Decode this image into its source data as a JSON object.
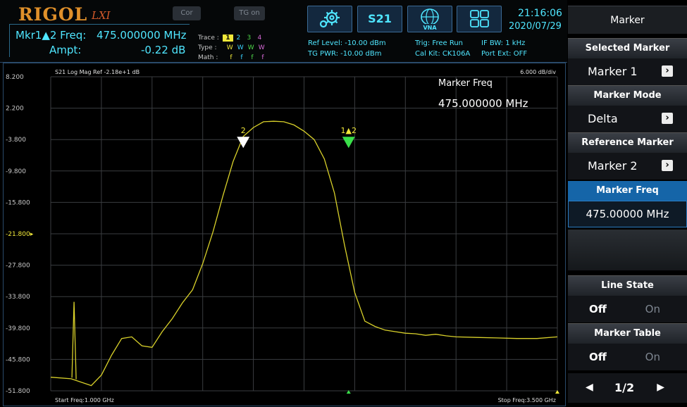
{
  "brand": {
    "logo": "RIGOL",
    "lxi": "LXI"
  },
  "top_buttons": {
    "cor": "Cor",
    "tg_on": "TG on",
    "s21": "S21",
    "vna": "VNA"
  },
  "marker_readout": {
    "freq_label": "Mkr1▲2 Freq:",
    "freq_value": "475.000000 MHz",
    "ampt_label": "Ampt:",
    "ampt_value": "-0.22 dB"
  },
  "trace_panel": {
    "trace_label": "Trace :",
    "trace_values": [
      "1",
      "2",
      "3",
      "4"
    ],
    "type_label": "Type :",
    "type_values": [
      "W",
      "W",
      "W",
      "W"
    ],
    "math_label": "Math :",
    "math_values": [
      "f",
      "f",
      "f",
      "f"
    ],
    "trace_colors": [
      "#f1e83a",
      "#3ad1ff",
      "#4fd94a",
      "#d96ad9"
    ]
  },
  "status": {
    "ref_level": "Ref Level: -10.00 dBm",
    "tg_pwr": "TG PWR: -10.00 dBm",
    "trig": "Trig: Free Run",
    "cal_kit": "Cal Kit: CK106A",
    "if_bw": "IF BW: 1 kHz",
    "port_ext": "Port Ext: OFF"
  },
  "clock": {
    "time": "21:16:06",
    "date": "2020/07/29"
  },
  "plot": {
    "header_left": "S21  Log Mag    Ref -2.18e+1 dB",
    "header_right": "6.000  dB/div",
    "y_ticks": [
      "8.200",
      "2.200",
      "-3.800",
      "-9.800",
      "-15.800",
      "-21.800",
      "-27.800",
      "-33.800",
      "-39.800",
      "-45.800",
      "-51.800"
    ],
    "start_freq": "Start Freq:1.000 GHz",
    "stop_freq": "Stop Freq:3.500 GHz",
    "marker_freq_title": "Marker Freq",
    "marker_freq_value": "475.000000 MHz",
    "marker_2_label": "2",
    "marker_1_label": "1▲2",
    "trace_color": "#d9d12a"
  },
  "chart_data": {
    "type": "line",
    "x_unit": "GHz",
    "xlim": [
      1.0,
      3.5
    ],
    "ylim": [
      -51.8,
      8.2
    ],
    "y_unit": "dB",
    "x": [
      1.0,
      1.1,
      1.2,
      1.25,
      1.3,
      1.35,
      1.4,
      1.45,
      1.5,
      1.55,
      1.6,
      1.65,
      1.7,
      1.75,
      1.8,
      1.85,
      1.9,
      1.95,
      2.0,
      2.05,
      2.1,
      2.15,
      2.2,
      2.25,
      2.3,
      2.35,
      2.4,
      2.45,
      2.5,
      2.55,
      2.6,
      2.65,
      2.7,
      2.75,
      2.8,
      2.85,
      2.9,
      2.95,
      3.0,
      3.1,
      3.2,
      3.3,
      3.4,
      3.5
    ],
    "y": [
      -49.2,
      -49.5,
      -50.8,
      -48.8,
      -45.0,
      -41.8,
      -41.5,
      -43.2,
      -43.5,
      -40.5,
      -38.0,
      -35.0,
      -32.5,
      -27.5,
      -21.5,
      -14.5,
      -8.0,
      -3.2,
      -1.5,
      -0.4,
      -0.3,
      -0.4,
      -1.0,
      -2.2,
      -3.8,
      -7.5,
      -14.0,
      -24.0,
      -33.0,
      -38.5,
      -39.5,
      -40.2,
      -40.5,
      -40.8,
      -40.9,
      -41.2,
      -41.0,
      -41.3,
      -41.5,
      -41.6,
      -41.7,
      -41.8,
      -41.8,
      -41.5
    ],
    "spur": {
      "x": 1.115,
      "y": -34.8
    },
    "markers": [
      {
        "label": "2",
        "x": 1.95,
        "y": -3.8,
        "color": "#ffffff"
      },
      {
        "label": "1▲2",
        "x": 2.47,
        "y": -3.8,
        "color": "#3ae04a"
      }
    ]
  },
  "menu": {
    "title": "Marker",
    "selected_marker_title": "Selected Marker",
    "selected_marker_value": "Marker 1",
    "marker_mode_title": "Marker Mode",
    "marker_mode_value": "Delta",
    "reference_marker_title": "Reference Marker",
    "reference_marker_value": "Marker 2",
    "marker_freq_title": "Marker Freq",
    "marker_freq_value": "475.00000 MHz",
    "line_state_title": "Line State",
    "line_state_off": "Off",
    "line_state_on": "On",
    "marker_table_title": "Marker Table",
    "marker_table_off": "Off",
    "marker_table_on": "On",
    "page": "1/2",
    "arrow_right": "›",
    "arrow_left_glyph": "◀",
    "arrow_right_glyph": "▶"
  }
}
